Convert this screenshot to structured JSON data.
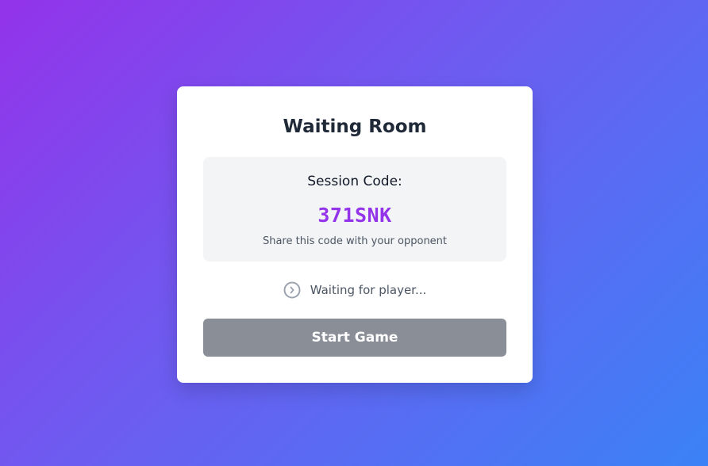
{
  "card": {
    "title": "Waiting Room",
    "session": {
      "label": "Session Code:",
      "code": "371SNK",
      "hint": "Share this code with your opponent"
    },
    "status": {
      "icon": "spinner-icon",
      "text": "Waiting for player..."
    },
    "start_button": {
      "label": "Start Game",
      "disabled": true
    }
  },
  "colors": {
    "gradient_start": "#9333ea",
    "gradient_end": "#3b82f6",
    "accent": "#9333ea",
    "button_disabled": "#8a8f97"
  }
}
